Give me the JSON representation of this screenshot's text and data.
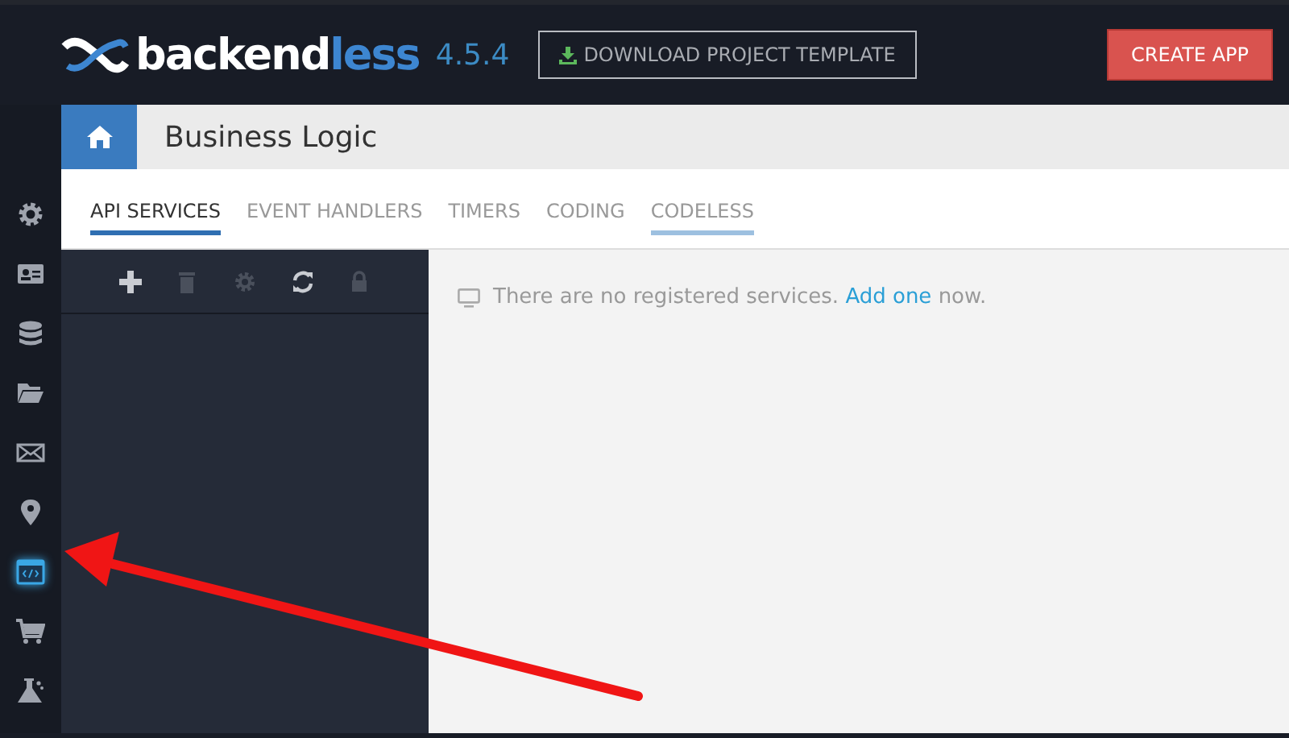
{
  "header": {
    "logo": {
      "main": "backend",
      "accent": "less"
    },
    "version": "4.5.4",
    "download_button": "DOWNLOAD PROJECT TEMPLATE",
    "create_button": "CREATE APP"
  },
  "sidebar": {
    "items": [
      {
        "kind": "settings",
        "selected": false
      },
      {
        "kind": "users",
        "selected": false
      },
      {
        "kind": "data",
        "selected": false
      },
      {
        "kind": "files",
        "selected": false
      },
      {
        "kind": "messaging",
        "selected": false
      },
      {
        "kind": "geo",
        "selected": false
      },
      {
        "kind": "code",
        "selected": true
      },
      {
        "kind": "marketplace",
        "selected": false
      },
      {
        "kind": "lab",
        "selected": false
      }
    ]
  },
  "page": {
    "title": "Business Logic"
  },
  "tabs": [
    {
      "label": "API SERVICES",
      "selected": true,
      "highlighted": false
    },
    {
      "label": "EVENT HANDLERS",
      "selected": false,
      "highlighted": false
    },
    {
      "label": "TIMERS",
      "selected": false,
      "highlighted": false
    },
    {
      "label": "CODING",
      "selected": false,
      "highlighted": false
    },
    {
      "label": "CODELESS",
      "selected": false,
      "highlighted": true
    }
  ],
  "toolbar": [
    {
      "kind": "add",
      "disabled": false
    },
    {
      "kind": "delete",
      "disabled": true
    },
    {
      "kind": "settings",
      "disabled": true
    },
    {
      "kind": "refresh",
      "disabled": false
    },
    {
      "kind": "lock",
      "disabled": true
    }
  ],
  "empty_message": {
    "before": "There are no registered services.",
    "link": "Add one",
    "after": "now."
  }
}
